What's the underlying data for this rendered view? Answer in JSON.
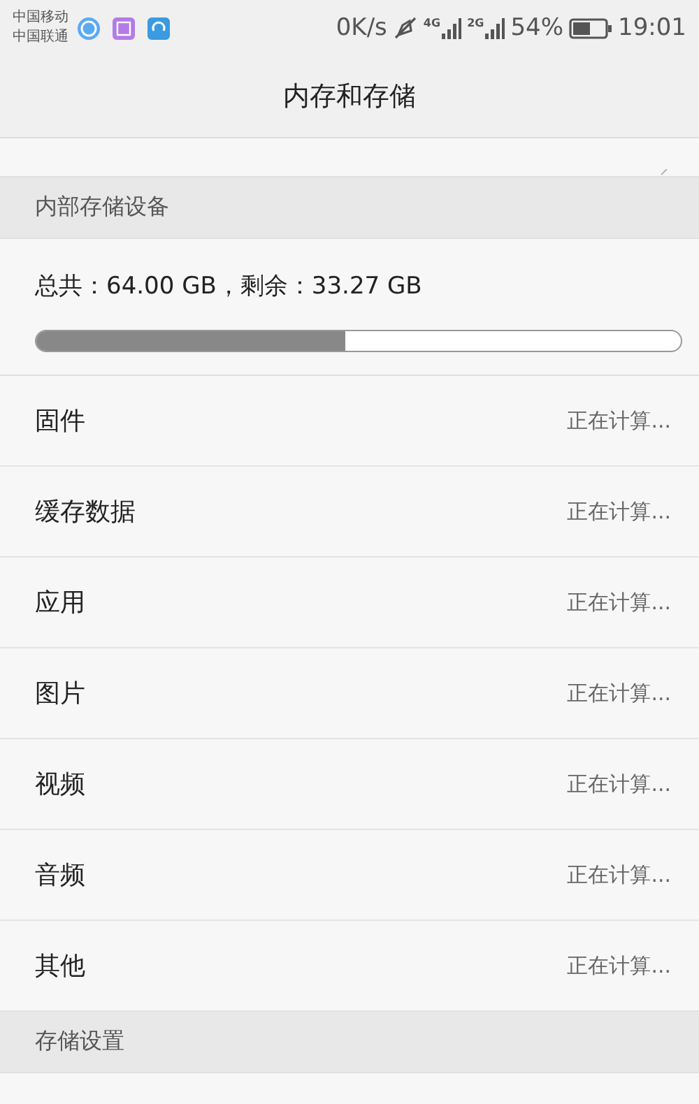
{
  "status_bar": {
    "carriers": [
      "中国移动",
      "中国联通"
    ],
    "speed": "0K/s",
    "network_labels": [
      "4G",
      "2G"
    ],
    "battery": "54%",
    "time": "19:01"
  },
  "title": "内存和存储",
  "sections": [
    {
      "header": "内部存储设备"
    },
    {
      "header": "存储设置"
    }
  ],
  "storage": {
    "summary": "总共：64.00 GB，剩余：33.27 GB",
    "level": 0.48
  },
  "items": [
    {
      "label": "固件",
      "value": "正在计算..."
    },
    {
      "label": "缓存数据",
      "value": "正在计算..."
    },
    {
      "label": "应用",
      "value": "正在计算..."
    },
    {
      "label": "图片",
      "value": "正在计算..."
    },
    {
      "label": "视频",
      "value": "正在计算..."
    },
    {
      "label": "音频",
      "value": "正在计算..."
    },
    {
      "label": "其他",
      "value": "正在计算..."
    }
  ]
}
